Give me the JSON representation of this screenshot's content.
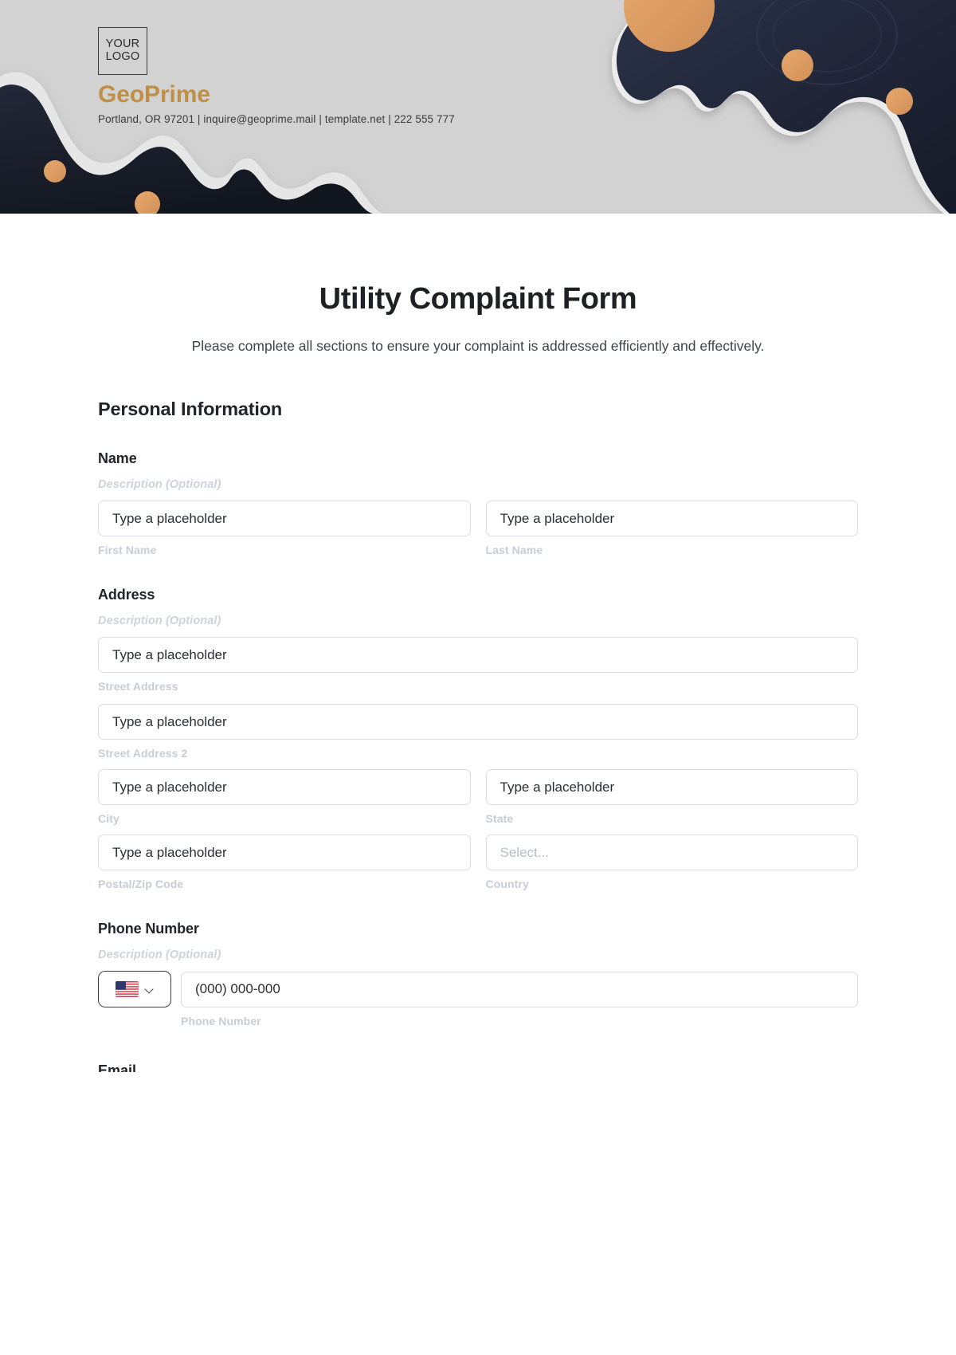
{
  "brand": {
    "logo_line1": "YOUR",
    "logo_line2": "LOGO",
    "name": "GeoPrime",
    "contact": "Portland, OR 97201 | inquire@geoprime.mail | template.net | 222 555 777",
    "accent_color": "#bf8f46",
    "banner_bg": "#d2d2d2",
    "banner_dark": "#252b3d",
    "banner_wave": "#e8e8e8"
  },
  "form": {
    "title": "Utility Complaint Form",
    "subtitle": "Please complete all sections to ensure your complaint is addressed efficiently and effectively.",
    "section_personal": "Personal Information",
    "description_optional": "Description (Optional)",
    "placeholder_text": "Type a placeholder",
    "placeholder_select": "Select...",
    "placeholder_phone": "(000) 000-000"
  },
  "fields": {
    "name": {
      "label": "Name",
      "desc": "Description (Optional)",
      "first": {
        "placeholder": "Type a placeholder",
        "sub": "First Name"
      },
      "last": {
        "placeholder": "Type a placeholder",
        "sub": "Last Name"
      }
    },
    "address": {
      "label": "Address",
      "desc": "Description (Optional)",
      "street": {
        "placeholder": "Type a placeholder",
        "sub": "Street Address"
      },
      "street2": {
        "placeholder": "Type a placeholder",
        "sub": "Street Address 2"
      },
      "city": {
        "placeholder": "Type a placeholder",
        "sub": "City"
      },
      "state": {
        "placeholder": "Type a placeholder",
        "sub": "State"
      },
      "postal": {
        "placeholder": "Type a placeholder",
        "sub": "Postal/Zip Code"
      },
      "country": {
        "placeholder": "Select...",
        "sub": "Country"
      }
    },
    "phone": {
      "label": "Phone Number",
      "desc": "Description (Optional)",
      "country_flag": "us-flag-icon",
      "placeholder": "(000) 000-000",
      "sub": "Phone Number"
    },
    "email": {
      "label": "Email"
    }
  }
}
